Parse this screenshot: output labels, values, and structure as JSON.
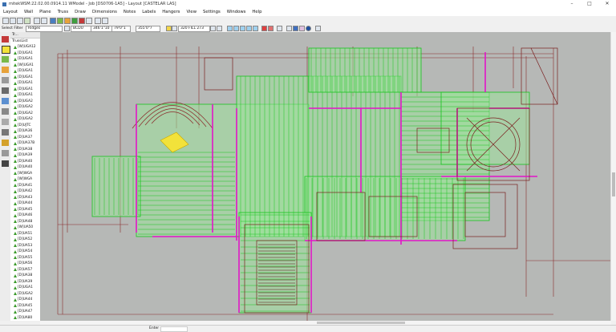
{
  "window": {
    "title": "mitekWSM:22.02.00.0914.11 WModel - Job [DS0706-1A5] - Layout [CASTELAR LAS]",
    "minimize_glyph": "–",
    "maximize_glyph": "□",
    "close_glyph": "✕"
  },
  "menu": [
    "Layout",
    "Wall",
    "Plane",
    "Truss",
    "Draw",
    "Dimensions",
    "Notes",
    "Labels",
    "Hangers",
    "View",
    "Settings",
    "Windows",
    "Help"
  ],
  "toolbar": {
    "layer_value": "BCDU",
    "coord_x": "346'1\"10",
    "coord_y": "79'0\"1",
    "coord_z": "355'0\"7",
    "truss_select_value": "320 FILL 273",
    "select_filter_label": "Select Filter",
    "filter_value": "Ridges"
  },
  "panel": {
    "header": "Tr...",
    "root": "TrussList",
    "items": [
      "[W]UGA12",
      "[D]UGA1",
      "[D]UGA1",
      "[W]UGA1",
      "[D]UGA1",
      "[D]UGA1",
      "[D]UGA1",
      "[D]UGA1",
      "[D]UGA1",
      "[D]UGA2",
      "[D]UGA2",
      "[D]UGA2",
      "[D]UGA2",
      "[D]UJTC",
      "[D]UA36",
      "[D]UA37",
      "[D]UA37B",
      "[D]UA38",
      "[D]UA39",
      "[D]UA40",
      "[D]UA40",
      "[W]WGA",
      "[W]WGA",
      "[D]UA41",
      "[D]UA42",
      "[D]UA43",
      "[D]UA44",
      "[D]UA45",
      "[D]UA46",
      "[D]UA48",
      "[W]UA50",
      "[D]UA51",
      "[D]UA52",
      "[D]UA53",
      "[D]UA54",
      "[D]UA55",
      "[D]UA56",
      "[D]UA57",
      "[D]UA38",
      "[D]UA39",
      "[D]UGA1",
      "[D]UGA2",
      "[D]UA44",
      "[D]UA45",
      "[D]UA47",
      "[D]UA80",
      "[D]UA60",
      "[D]UA61"
    ]
  },
  "status": {
    "command_label": "Enter"
  },
  "colors": {
    "canvas_bg": "#b6b8b6",
    "truss_fill": "#9de29a",
    "truss_line": "#18c41e",
    "beam": "#e214c8",
    "wall": "#7a1f1f",
    "selected": "#f2e23a"
  }
}
